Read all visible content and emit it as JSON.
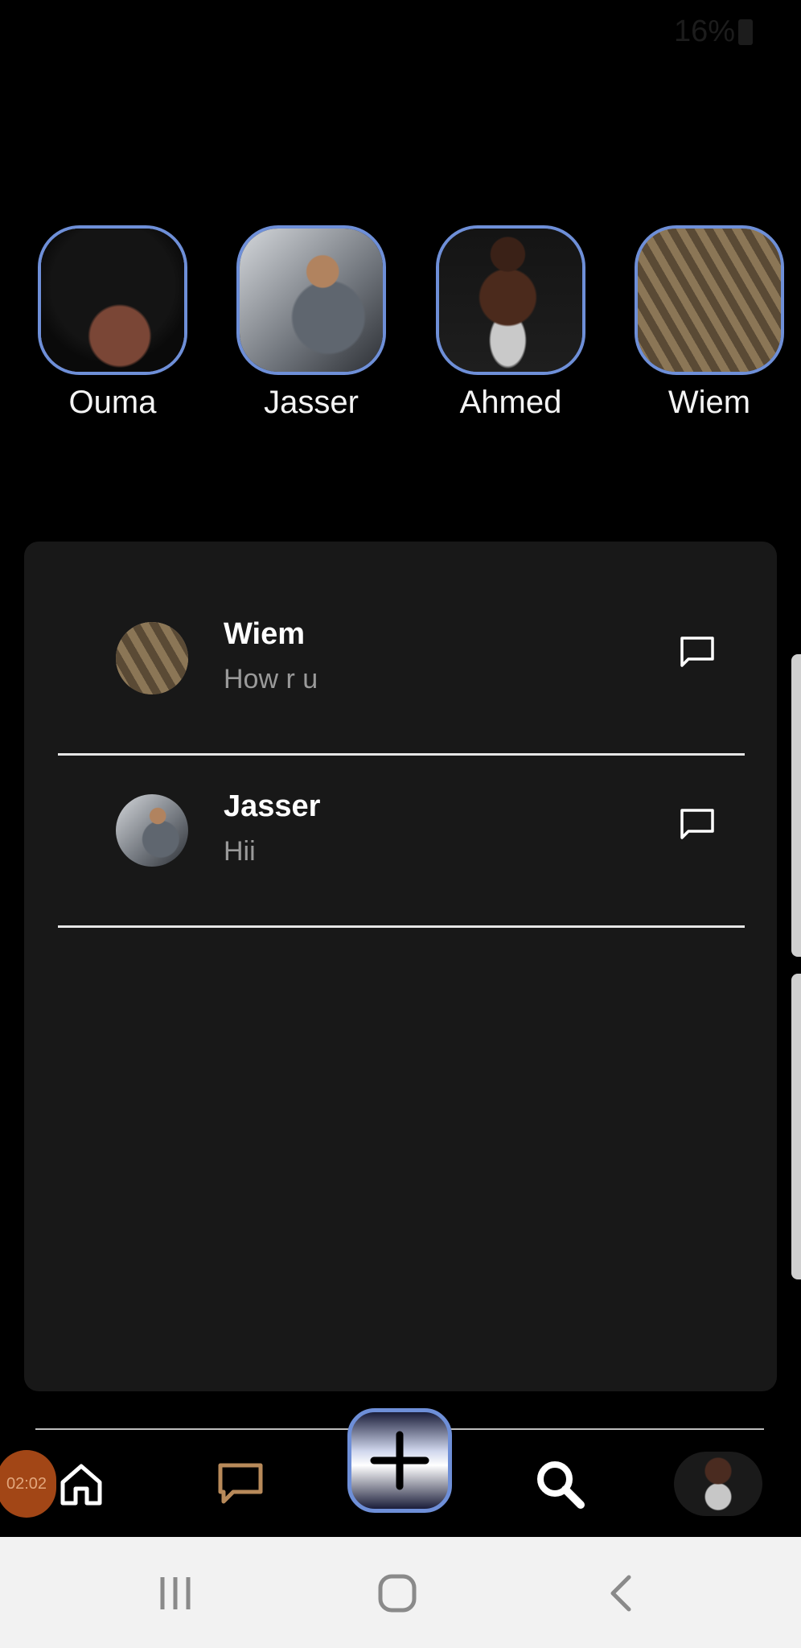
{
  "status_bar": {
    "battery_text": "16%"
  },
  "stories": [
    {
      "name": "Ouma"
    },
    {
      "name": "Jasser"
    },
    {
      "name": "Ahmed"
    },
    {
      "name": "Wiem"
    }
  ],
  "chats": [
    {
      "name": "Wiem",
      "last_message": "How r u"
    },
    {
      "name": "Jasser",
      "last_message": "Hii"
    }
  ],
  "bottom_nav": {
    "timer_text": "02:02",
    "items": [
      "home-icon",
      "chat-icon",
      "add-icon",
      "search-icon",
      "profile-avatar"
    ]
  },
  "colors": {
    "accent_ring": "#6e8fd8",
    "panel_bg": "#181818",
    "timer_bg": "#a24616",
    "chat_nav_icon": "#b88a5a"
  }
}
